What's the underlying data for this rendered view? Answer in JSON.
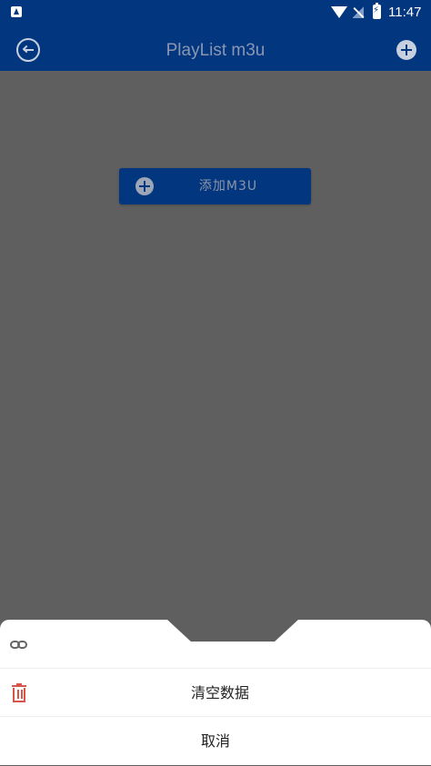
{
  "status_bar": {
    "time": "11:47",
    "icons": [
      "app-notification-icon",
      "wifi-icon",
      "signal-off-icon",
      "battery-charging-icon"
    ]
  },
  "toolbar": {
    "title": "PlayList m3u",
    "back_icon": "back-arrow-circle-icon",
    "add_icon": "plus-circle-icon"
  },
  "main": {
    "add_m3u_label": "添加M3U",
    "add_m3u_icon": "plus-circle-icon"
  },
  "bottom_sheet": {
    "items": [
      {
        "icon": "link-icon",
        "label": ""
      },
      {
        "icon": "trash-icon",
        "label": "清空数据"
      },
      {
        "icon": "",
        "label": "取消"
      }
    ]
  },
  "colors": {
    "primary": "#02367f",
    "overlay": "#5f5f5f",
    "danger": "#d7564c",
    "sheet": "#ffffff"
  }
}
